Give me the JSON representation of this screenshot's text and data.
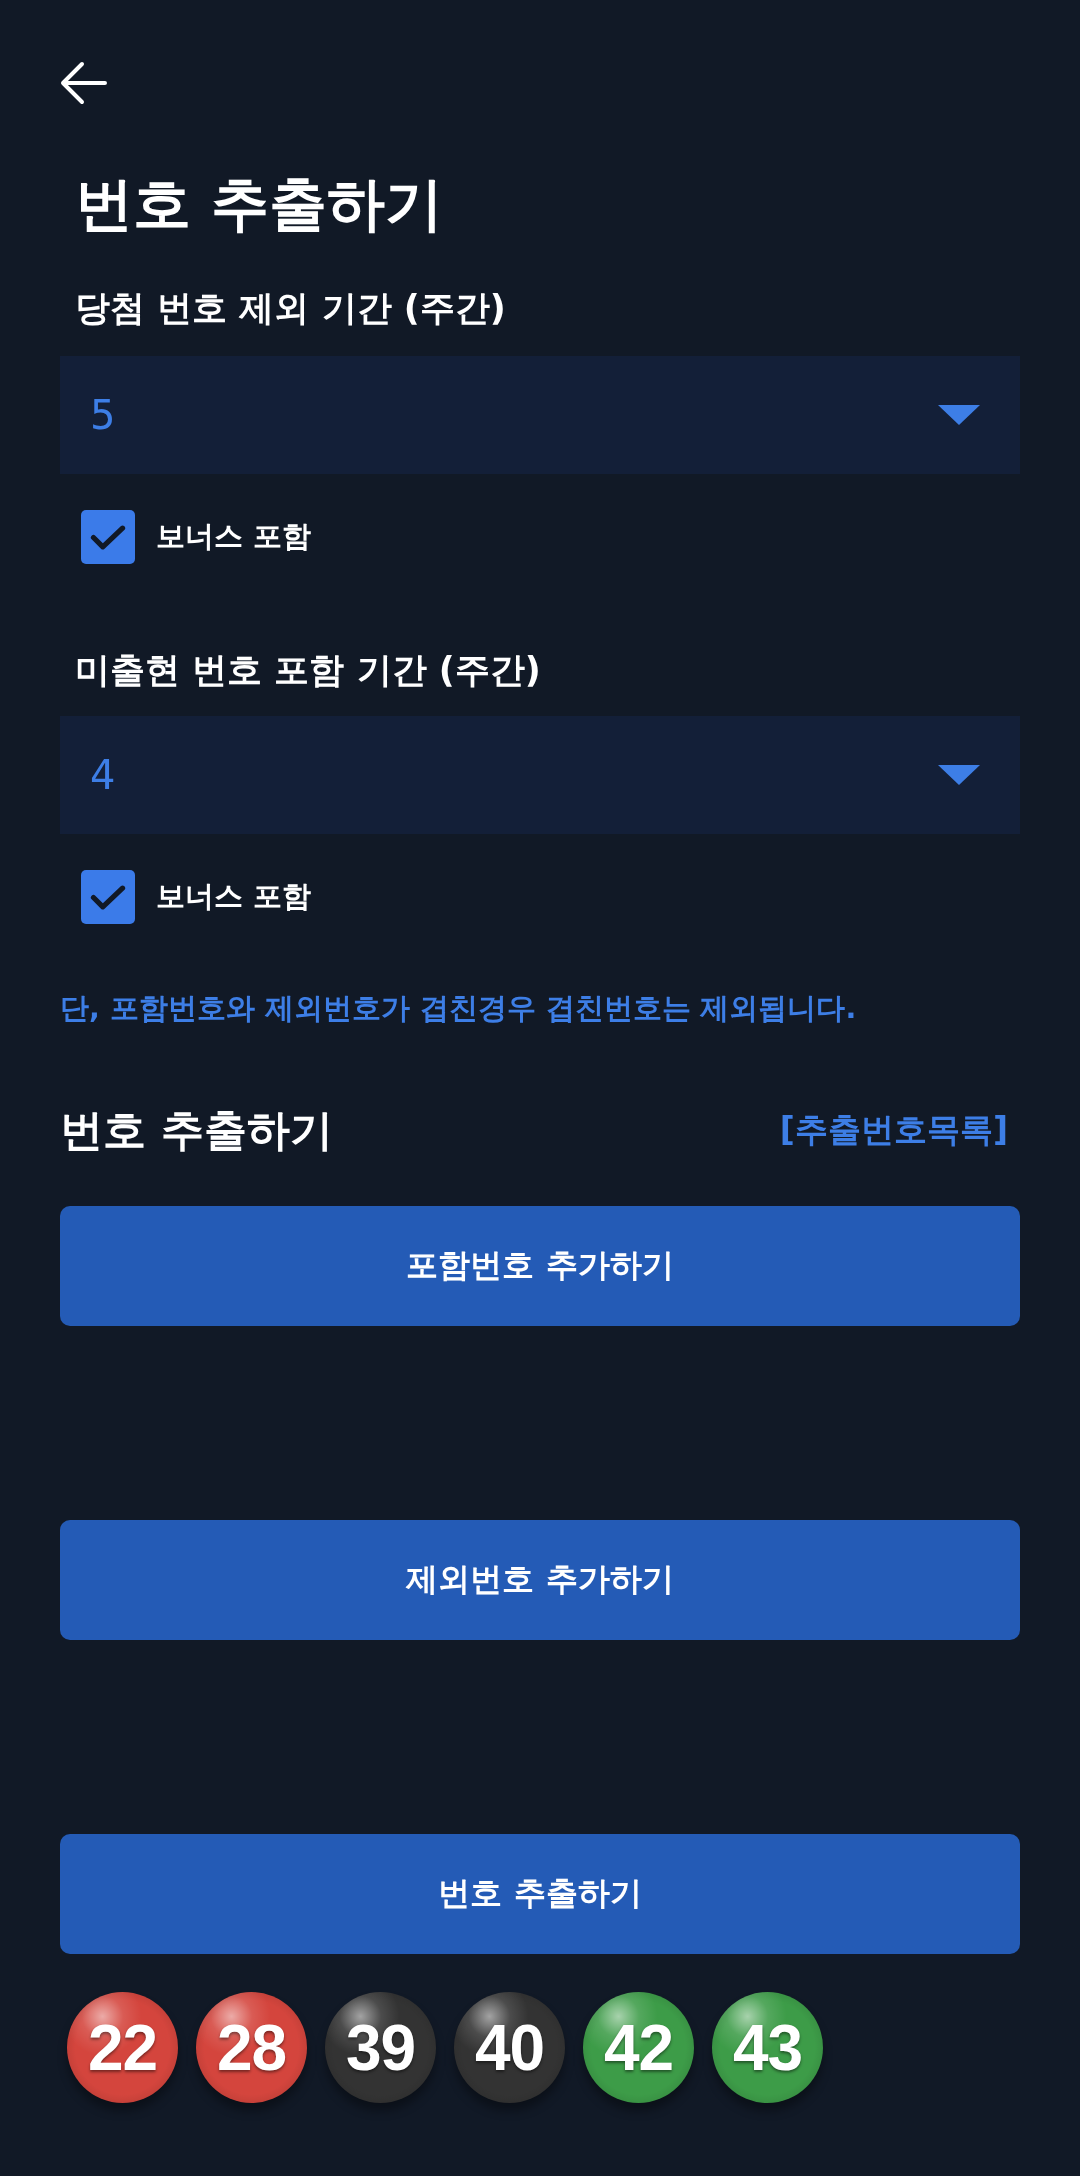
{
  "header": {
    "title": "번호 추출하기"
  },
  "settings": [
    {
      "label": "당첨 번호 제외 기간 (주간)",
      "value": "5",
      "bonus": {
        "label": "보너스 포함",
        "checked": true
      }
    },
    {
      "label": "미출현 번호 포함 기간 (주간)",
      "value": "4",
      "bonus": {
        "label": "보너스 포함",
        "checked": true
      }
    }
  ],
  "note": "단, 포함번호와 제외번호가 겹친경우 겹친번호는 제외됩니다.",
  "draw_section": {
    "title": "번호 추출하기",
    "link": "[추출번호목록]"
  },
  "buttons": [
    {
      "label": "포함번호 추가하기"
    },
    {
      "label": "제외번호 추가하기"
    },
    {
      "label": "번호 추출하기"
    }
  ],
  "balls": [
    {
      "number": "22",
      "color": "#d4453d"
    },
    {
      "number": "28",
      "color": "#d4453d"
    },
    {
      "number": "39",
      "color": "#333333"
    },
    {
      "number": "40",
      "color": "#333333"
    },
    {
      "number": "42",
      "color": "#3d9c48"
    },
    {
      "number": "43",
      "color": "#3d9c48"
    }
  ]
}
